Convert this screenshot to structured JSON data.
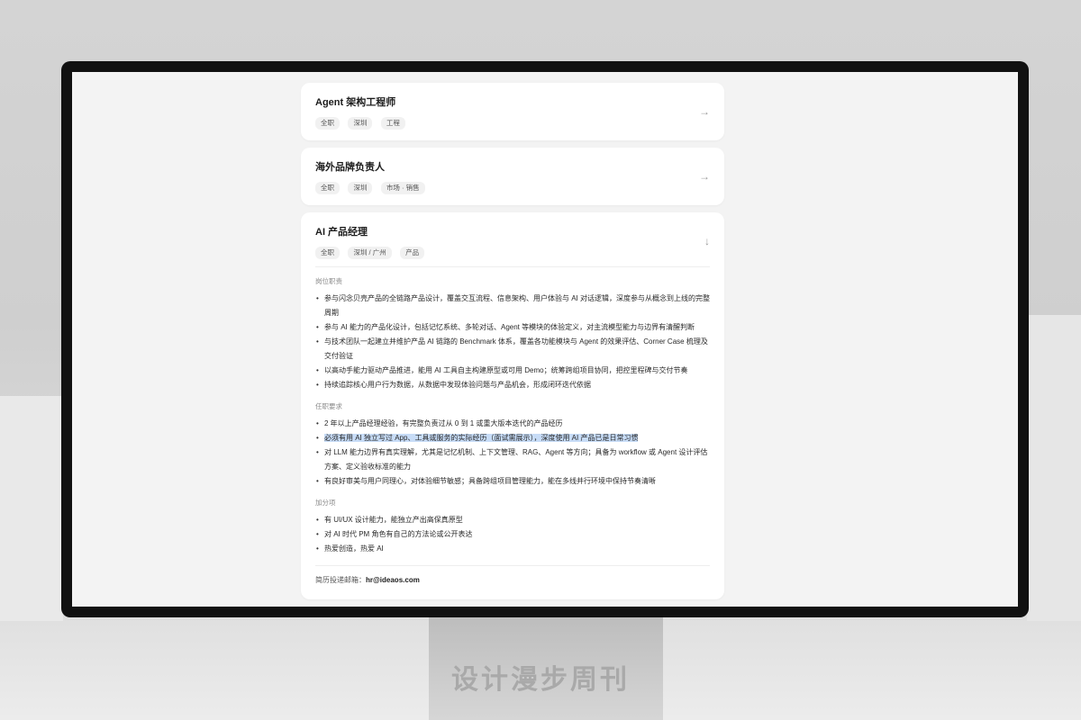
{
  "jobs": [
    {
      "title": "Agent 架构工程师",
      "tags": [
        "全职",
        "深圳",
        "工程"
      ],
      "arrow": "→"
    },
    {
      "title": "海外品牌负责人",
      "tags": [
        "全职",
        "深圳",
        "市场 · 销售"
      ],
      "arrow": "→"
    },
    {
      "title": "AI 产品经理",
      "tags": [
        "全职",
        "深圳 / 广州",
        "产品"
      ],
      "arrow": "↓"
    }
  ],
  "detail": {
    "sections": [
      {
        "title": "岗位职责",
        "items": [
          "参与闪念贝壳产品的全链路产品设计，覆盖交互流程、信息架构、用户体验与 AI 对话逻辑，深度参与从概念到上线的完整周期",
          "参与 AI 能力的产品化设计，包括记忆系统、多轮对话、Agent 等模块的体验定义，对主流模型能力与边界有清醒判断",
          "与技术团队一起建立并维护产品 AI 链路的 Benchmark 体系，覆盖各功能模块与 Agent 的效果评估、Corner Case 梳理及交付验证",
          "以高动手能力驱动产品推进，能用 AI 工具自主构建原型或可用 Demo；统筹跨组项目协同，把控里程碑与交付节奏",
          "持续追踪核心用户行为数据，从数据中发现体验问题与产品机会，形成闭环迭代依据"
        ]
      },
      {
        "title": "任职要求",
        "items": [
          "2 年以上产品经理经验，有完整负责过从 0 到 1 或重大版本迭代的产品经历",
          "必须有用 AI 独立写过 App、工具或服务的实际经历（面试需展示），深度使用 AI 产品已是日常习惯",
          "对 LLM 能力边界有真实理解，尤其是记忆机制、上下文管理、RAG、Agent 等方向；具备为 workflow 或 Agent 设计评估方案、定义验收标准的能力",
          "有良好审美与用户同理心，对体验细节敏感；具备跨组项目管理能力，能在多线并行环境中保持节奏清晰"
        ]
      },
      {
        "title": "加分项",
        "items": [
          "有 UI/UX 设计能力，能独立产出高保真原型",
          "对 AI 时代 PM 角色有自己的方法论或公开表达",
          "热爱创造，热爱 AI"
        ]
      }
    ],
    "email_label": "简历投递邮箱：",
    "email": "hr@ideaos.com"
  },
  "watermark": "设计漫步周刊",
  "colors": {
    "highlight": "#c7dcf7",
    "screen_bg": "#f3f3f3",
    "card_bg": "#ffffff"
  }
}
